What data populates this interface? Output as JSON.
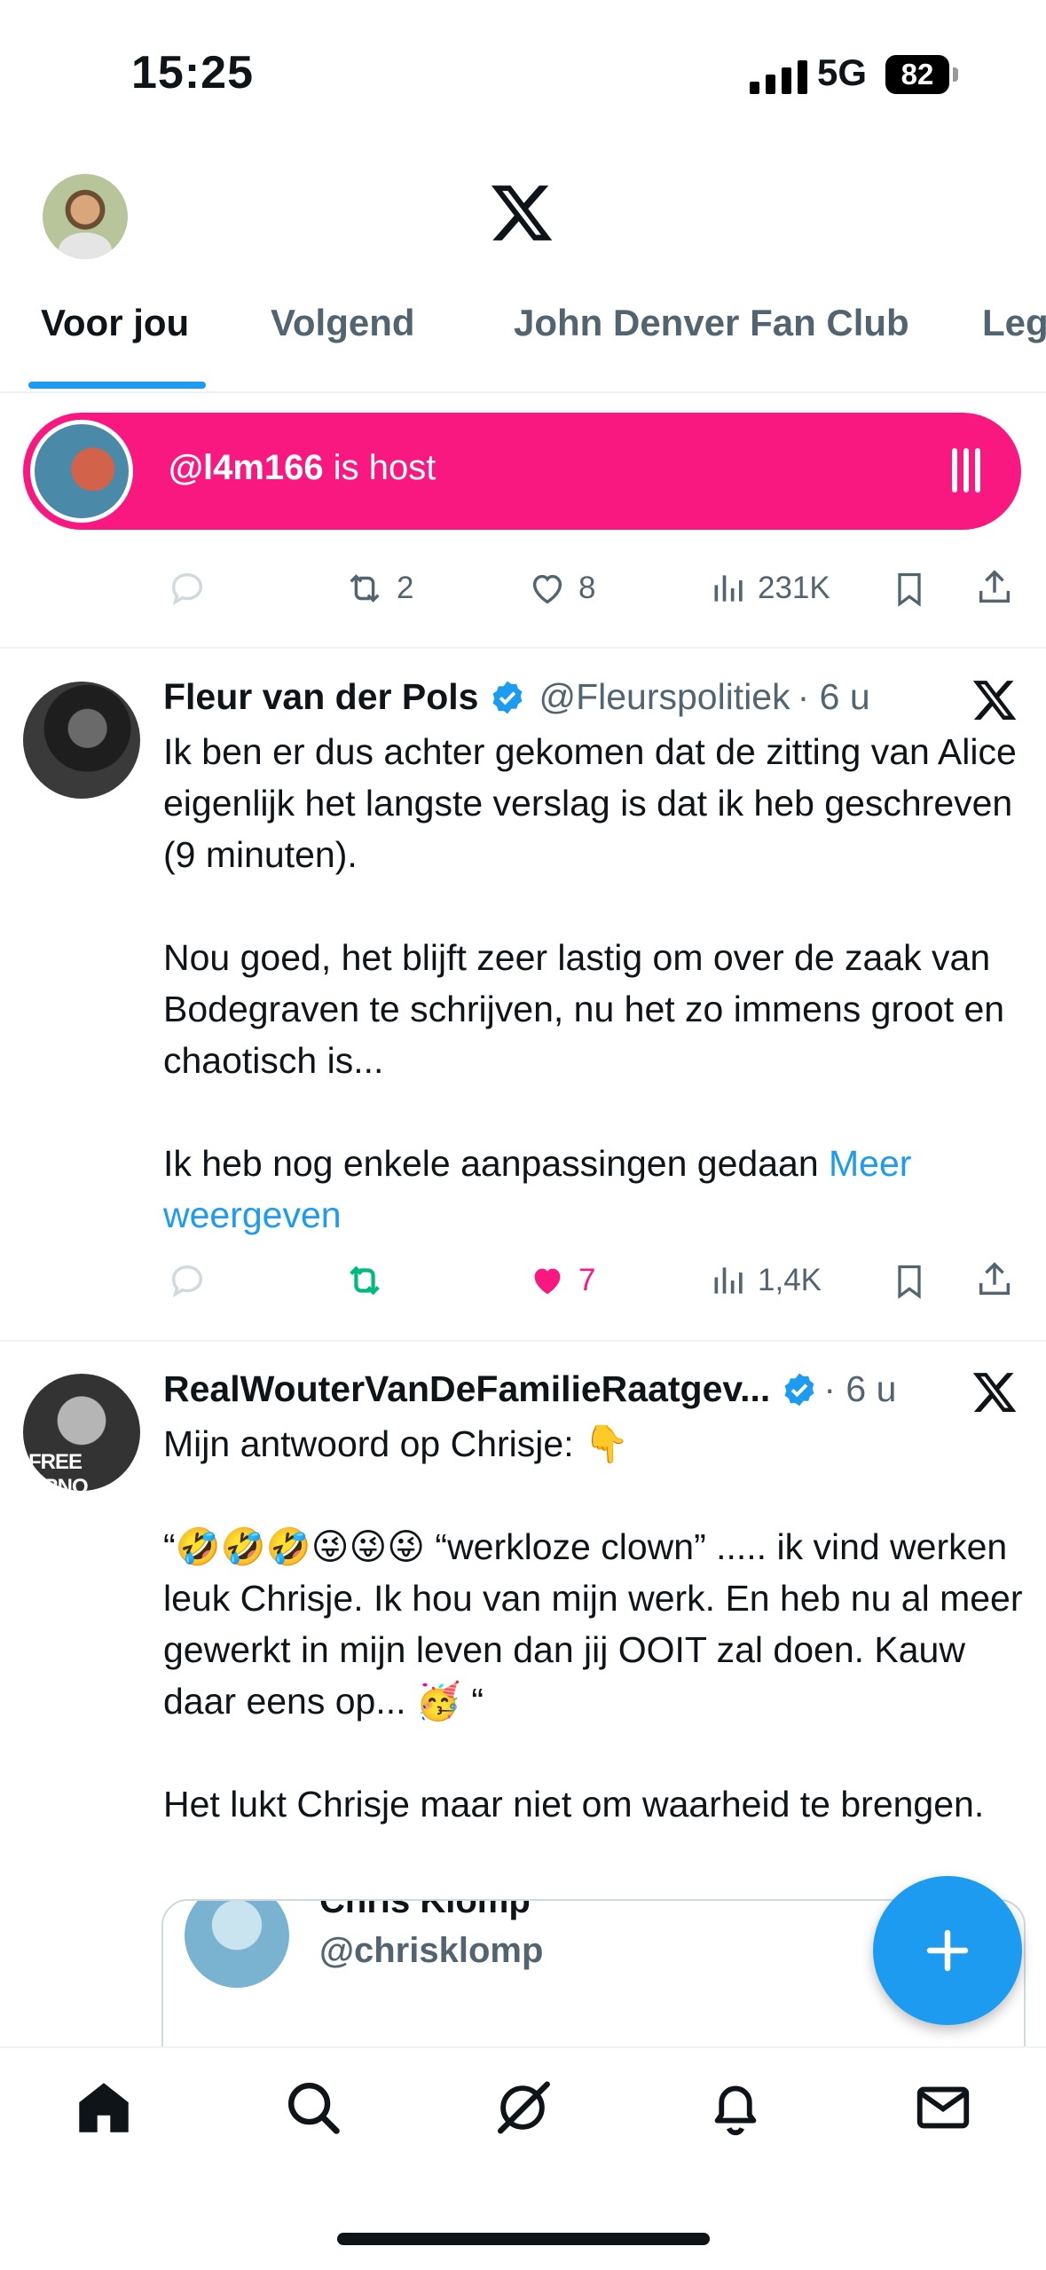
{
  "status_bar": {
    "time": "15:25",
    "network": "5G",
    "battery": "82"
  },
  "tabs": [
    "Voor jou",
    "Volgend",
    "John Denver Fan Club",
    "Leg"
  ],
  "space": {
    "host_handle": "@l4m166",
    "host_suffix": " is host"
  },
  "prev_post_actions": {
    "reposts": "2",
    "likes": "8",
    "views": "231K"
  },
  "post1": {
    "name": "Fleur van der Pols",
    "handle": "@Fleurspolitiek",
    "time": "· 6 u",
    "paragraph1": "Ik ben er dus achter gekomen dat de zitting van Alice eigenlijk het langste verslag is dat ik heb geschreven (9 minuten).",
    "paragraph2": "Nou goed, het blijft zeer lastig om over de zaak van Bodegraven te schrijven, nu het zo immens groot en chaotisch is...",
    "paragraph3": "Ik heb nog enkele aanpassingen gedaan ",
    "more_link": "Meer weergeven",
    "likes": "7",
    "views": "1,4K"
  },
  "post2": {
    "name": "RealWouterVanDeFamilieRaatgev...",
    "time": "· 6 u",
    "paragraph1": "Mijn antwoord op Chrisje:  👇",
    "paragraph2": "“🤣🤣🤣😜😜😜 “werkloze clown” ..... ik vind werken leuk Chrisje. Ik hou van mijn werk. En heb nu al meer gewerkt in mijn leven dan jij OOIT zal doen. Kauw daar eens op... 🥳 “",
    "paragraph3": "Het lukt Chrisje maar niet om waarheid te brengen.",
    "avatar_text": "FREE ARNO"
  },
  "quoted": {
    "name": "Chris Klomp",
    "handle": "@chrisklomp"
  },
  "colors": {
    "accent": "#1d9bf0",
    "pink": "#f91880",
    "green": "#00ba7c",
    "muted": "#536471"
  },
  "nav": [
    "home-icon",
    "search-icon",
    "grok-icon",
    "notifications-icon",
    "messages-icon"
  ]
}
